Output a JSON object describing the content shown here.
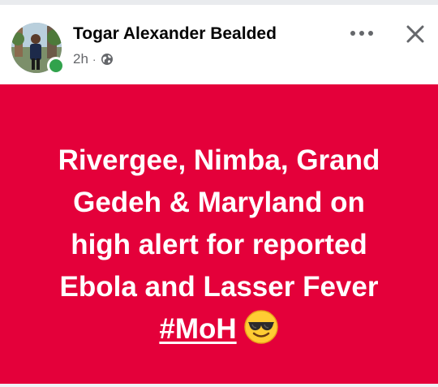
{
  "post": {
    "author": {
      "name": "Togar Alexander Bealded",
      "online": true
    },
    "meta": {
      "time": "2h",
      "separator": "·",
      "audience_icon": "globe-icon"
    },
    "actions": {
      "more_icon": "more-horizontal-icon",
      "close_icon": "close-icon"
    },
    "content": {
      "lines": [
        "Rivergee, Nimba, Grand",
        "Gedeh & Maryland on",
        "high alert for reported",
        "Ebola and Lasser Fever"
      ],
      "hashtag": "#MoH",
      "emoji": "smiling-face-with-sunglasses-icon",
      "background_color": "#e4003a",
      "text_color": "#ffffff"
    }
  },
  "colors": {
    "online_status": "#31a24c",
    "meta_text": "#65676b",
    "name_text": "#050505"
  }
}
